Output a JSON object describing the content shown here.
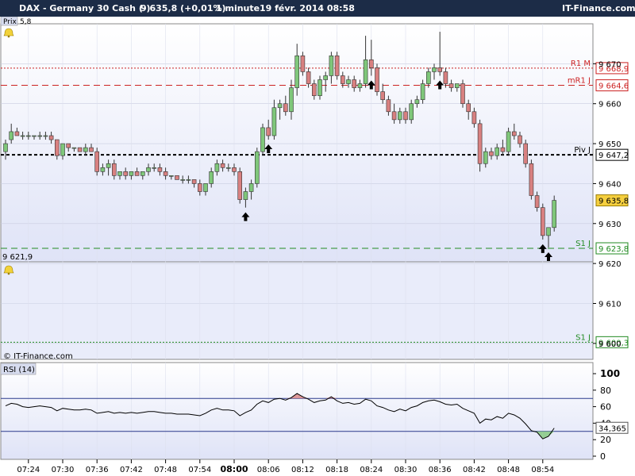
{
  "header": {
    "instrument": "DAX - Germany 30 Cash (-)",
    "quote": "9 635,8 (+0,01%)",
    "timeframe": "1 minute",
    "datetime": "19 févr. 2014 08:58",
    "brand": "IT-Finance.com"
  },
  "panels": {
    "price_tab": "Prix",
    "price_tab_value": "5,8",
    "rsi_tab": "RSI (14)",
    "watermark": "© IT-Finance.com",
    "low_label": "9 621,9"
  },
  "colors": {
    "titlebar": "#1c2c47",
    "up_candle": "#7fc77a",
    "down_candle": "#d88080",
    "panel_bg": "#e9ecfa",
    "resistance": "#cc2222",
    "support": "#228b22",
    "pivot": "#000000",
    "rsi_line": "#000000",
    "rsi_bands": "#2b3a8c"
  },
  "chart_data": [
    {
      "type": "candlestick",
      "title": "DAX - Germany 30 Cash (-)",
      "xlabel": "",
      "ylabel": "",
      "ylim": [
        9596,
        9680
      ],
      "x_ticks": [
        "07:24",
        "07:30",
        "07:36",
        "07:42",
        "07:48",
        "07:54",
        "08:00",
        "08:06",
        "08:12",
        "08:18",
        "08:24",
        "08:30",
        "08:36",
        "08:42",
        "08:48",
        "08:54"
      ],
      "x_tick_emphasis": "08:00",
      "y_ticks": [
        {
          "value": 9600,
          "label": "9 600"
        },
        {
          "value": 9610,
          "label": "9 610"
        },
        {
          "value": 9620,
          "label": "9 620"
        },
        {
          "value": 9630,
          "label": "9 630"
        },
        {
          "value": 9640,
          "label": "9 640"
        },
        {
          "value": 9650,
          "label": "9 650"
        },
        {
          "value": 9660,
          "label": "9 660"
        },
        {
          "value": 9670,
          "label": "9 670"
        }
      ],
      "levels": [
        {
          "name": "R1 M",
          "value": 9668.9,
          "label": "9 668,9",
          "style": "dotted",
          "color": "#cc2222"
        },
        {
          "name": "mR1 J",
          "value": 9664.6,
          "label": "9 664,6",
          "style": "dashed",
          "color": "#cc2222"
        },
        {
          "name": "Piv J",
          "value": 9647.2,
          "label": "9 647,2",
          "style": "dashed-bold",
          "color": "#000000"
        },
        {
          "name": "S1 J",
          "value": 9623.8,
          "label": "9 623,8",
          "style": "dashed",
          "color": "#228b22"
        },
        {
          "name": "S1 J",
          "value": 9600.3,
          "label": "9 600,3",
          "style": "dotted",
          "color": "#228b22"
        }
      ],
      "last": {
        "value": 9635.8,
        "label": "9 635,8"
      },
      "candles": [
        {
          "t": "07:20",
          "o": 9648,
          "h": 9651,
          "l": 9646,
          "c": 9650
        },
        {
          "t": "07:21",
          "o": 9651,
          "h": 9655,
          "l": 9650,
          "c": 9653
        },
        {
          "t": "07:22",
          "o": 9653,
          "h": 9654,
          "l": 9652,
          "c": 9652
        },
        {
          "t": "07:23",
          "o": 9652,
          "h": 9653,
          "l": 9651,
          "c": 9652
        },
        {
          "t": "07:24",
          "o": 9652,
          "h": 9653,
          "l": 9651,
          "c": 9652
        },
        {
          "t": "07:25",
          "o": 9652,
          "h": 9652,
          "l": 9651,
          "c": 9652
        },
        {
          "t": "07:26",
          "o": 9652,
          "h": 9653,
          "l": 9651,
          "c": 9652
        },
        {
          "t": "07:27",
          "o": 9652,
          "h": 9653,
          "l": 9651,
          "c": 9652
        },
        {
          "t": "07:28",
          "o": 9652,
          "h": 9653,
          "l": 9650,
          "c": 9651
        },
        {
          "t": "07:29",
          "o": 9651,
          "h": 9651,
          "l": 9646,
          "c": 9647
        },
        {
          "t": "07:30",
          "o": 9647,
          "h": 9650,
          "l": 9646,
          "c": 9650
        },
        {
          "t": "07:31",
          "o": 9650,
          "h": 9650,
          "l": 9648,
          "c": 9649
        },
        {
          "t": "07:32",
          "o": 9649,
          "h": 9649,
          "l": 9648,
          "c": 9649
        },
        {
          "t": "07:33",
          "o": 9649,
          "h": 9649,
          "l": 9648,
          "c": 9648
        },
        {
          "t": "07:34",
          "o": 9648,
          "h": 9650,
          "l": 9647,
          "c": 9649
        },
        {
          "t": "07:35",
          "o": 9649,
          "h": 9650,
          "l": 9648,
          "c": 9648
        },
        {
          "t": "07:36",
          "o": 9648,
          "h": 9649,
          "l": 9642,
          "c": 9643
        },
        {
          "t": "07:37",
          "o": 9643,
          "h": 9645,
          "l": 9642,
          "c": 9644
        },
        {
          "t": "07:38",
          "o": 9644,
          "h": 9646,
          "l": 9642,
          "c": 9645
        },
        {
          "t": "07:39",
          "o": 9645,
          "h": 9646,
          "l": 9641,
          "c": 9642
        },
        {
          "t": "07:40",
          "o": 9642,
          "h": 9643,
          "l": 9641,
          "c": 9643
        },
        {
          "t": "07:41",
          "o": 9643,
          "h": 9644,
          "l": 9641,
          "c": 9642
        },
        {
          "t": "07:42",
          "o": 9642,
          "h": 9643,
          "l": 9641,
          "c": 9643
        },
        {
          "t": "07:43",
          "o": 9643,
          "h": 9644,
          "l": 9642,
          "c": 9642
        },
        {
          "t": "07:44",
          "o": 9642,
          "h": 9643,
          "l": 9641,
          "c": 9643
        },
        {
          "t": "07:45",
          "o": 9643,
          "h": 9645,
          "l": 9642,
          "c": 9644
        },
        {
          "t": "07:46",
          "o": 9644,
          "h": 9645,
          "l": 9643,
          "c": 9644
        },
        {
          "t": "07:47",
          "o": 9644,
          "h": 9645,
          "l": 9642,
          "c": 9643
        },
        {
          "t": "07:48",
          "o": 9643,
          "h": 9644,
          "l": 9641,
          "c": 9642
        },
        {
          "t": "07:49",
          "o": 9642,
          "h": 9642,
          "l": 9641,
          "c": 9642
        },
        {
          "t": "07:50",
          "o": 9642,
          "h": 9642,
          "l": 9641,
          "c": 9641
        },
        {
          "t": "07:51",
          "o": 9641,
          "h": 9642,
          "l": 9640,
          "c": 9641
        },
        {
          "t": "07:52",
          "o": 9641,
          "h": 9642,
          "l": 9640,
          "c": 9641
        },
        {
          "t": "07:53",
          "o": 9641,
          "h": 9641,
          "l": 9639,
          "c": 9640
        },
        {
          "t": "07:54",
          "o": 9640,
          "h": 9641,
          "l": 9637,
          "c": 9638
        },
        {
          "t": "07:55",
          "o": 9638,
          "h": 9640,
          "l": 9637,
          "c": 9640
        },
        {
          "t": "07:56",
          "o": 9640,
          "h": 9644,
          "l": 9639,
          "c": 9643
        },
        {
          "t": "07:57",
          "o": 9643,
          "h": 9646,
          "l": 9642,
          "c": 9645
        },
        {
          "t": "07:58",
          "o": 9645,
          "h": 9646,
          "l": 9643,
          "c": 9644
        },
        {
          "t": "07:59",
          "o": 9644,
          "h": 9645,
          "l": 9643,
          "c": 9644
        },
        {
          "t": "08:00",
          "o": 9644,
          "h": 9645,
          "l": 9642,
          "c": 9643
        },
        {
          "t": "08:01",
          "o": 9643,
          "h": 9644,
          "l": 9635,
          "c": 9636
        },
        {
          "t": "08:02",
          "o": 9636,
          "h": 9639,
          "l": 9634,
          "c": 9638
        },
        {
          "t": "08:03",
          "o": 9638,
          "h": 9641,
          "l": 9636,
          "c": 9640
        },
        {
          "t": "08:04",
          "o": 9640,
          "h": 9649,
          "l": 9639,
          "c": 9648
        },
        {
          "t": "08:05",
          "o": 9648,
          "h": 9655,
          "l": 9647,
          "c": 9654
        },
        {
          "t": "08:06",
          "o": 9654,
          "h": 9656,
          "l": 9651,
          "c": 9652
        },
        {
          "t": "08:07",
          "o": 9652,
          "h": 9661,
          "l": 9651,
          "c": 9659
        },
        {
          "t": "08:08",
          "o": 9659,
          "h": 9661,
          "l": 9656,
          "c": 9660
        },
        {
          "t": "08:09",
          "o": 9660,
          "h": 9662,
          "l": 9657,
          "c": 9658
        },
        {
          "t": "08:10",
          "o": 9658,
          "h": 9666,
          "l": 9656,
          "c": 9664
        },
        {
          "t": "08:11",
          "o": 9664,
          "h": 9675,
          "l": 9662,
          "c": 9672
        },
        {
          "t": "08:12",
          "o": 9672,
          "h": 9673,
          "l": 9667,
          "c": 9668
        },
        {
          "t": "08:13",
          "o": 9668,
          "h": 9669,
          "l": 9664,
          "c": 9665
        },
        {
          "t": "08:14",
          "o": 9665,
          "h": 9666,
          "l": 9661,
          "c": 9662
        },
        {
          "t": "08:15",
          "o": 9662,
          "h": 9667,
          "l": 9661,
          "c": 9666
        },
        {
          "t": "08:16",
          "o": 9666,
          "h": 9668,
          "l": 9663,
          "c": 9667
        },
        {
          "t": "08:17",
          "o": 9667,
          "h": 9673,
          "l": 9665,
          "c": 9672
        },
        {
          "t": "08:18",
          "o": 9672,
          "h": 9673,
          "l": 9666,
          "c": 9667
        },
        {
          "t": "08:19",
          "o": 9667,
          "h": 9668,
          "l": 9664,
          "c": 9665
        },
        {
          "t": "08:20",
          "o": 9665,
          "h": 9667,
          "l": 9664,
          "c": 9666
        },
        {
          "t": "08:21",
          "o": 9666,
          "h": 9667,
          "l": 9663,
          "c": 9664
        },
        {
          "t": "08:22",
          "o": 9664,
          "h": 9666,
          "l": 9663,
          "c": 9665
        },
        {
          "t": "08:23",
          "o": 9665,
          "h": 9677,
          "l": 9664,
          "c": 9671
        },
        {
          "t": "08:24",
          "o": 9671,
          "h": 9676,
          "l": 9667,
          "c": 9669
        },
        {
          "t": "08:25",
          "o": 9669,
          "h": 9670,
          "l": 9662,
          "c": 9663
        },
        {
          "t": "08:26",
          "o": 9663,
          "h": 9665,
          "l": 9660,
          "c": 9661
        },
        {
          "t": "08:27",
          "o": 9661,
          "h": 9662,
          "l": 9657,
          "c": 9658
        },
        {
          "t": "08:28",
          "o": 9658,
          "h": 9660,
          "l": 9655,
          "c": 9656
        },
        {
          "t": "08:29",
          "o": 9656,
          "h": 9659,
          "l": 9655,
          "c": 9658
        },
        {
          "t": "08:30",
          "o": 9658,
          "h": 9659,
          "l": 9655,
          "c": 9656
        },
        {
          "t": "08:31",
          "o": 9656,
          "h": 9661,
          "l": 9655,
          "c": 9660
        },
        {
          "t": "08:32",
          "o": 9660,
          "h": 9662,
          "l": 9659,
          "c": 9661
        },
        {
          "t": "08:33",
          "o": 9661,
          "h": 9666,
          "l": 9660,
          "c": 9665
        },
        {
          "t": "08:34",
          "o": 9665,
          "h": 9669,
          "l": 9664,
          "c": 9668
        },
        {
          "t": "08:35",
          "o": 9668,
          "h": 9670,
          "l": 9666,
          "c": 9669
        },
        {
          "t": "08:36",
          "o": 9669,
          "h": 9678,
          "l": 9667,
          "c": 9668
        },
        {
          "t": "08:37",
          "o": 9668,
          "h": 9669,
          "l": 9664,
          "c": 9665
        },
        {
          "t": "08:38",
          "o": 9665,
          "h": 9666,
          "l": 9663,
          "c": 9664
        },
        {
          "t": "08:39",
          "o": 9664,
          "h": 9665,
          "l": 9663,
          "c": 9665
        },
        {
          "t": "08:40",
          "o": 9665,
          "h": 9666,
          "l": 9659,
          "c": 9660
        },
        {
          "t": "08:41",
          "o": 9660,
          "h": 9661,
          "l": 9656,
          "c": 9658
        },
        {
          "t": "08:42",
          "o": 9658,
          "h": 9659,
          "l": 9654,
          "c": 9655
        },
        {
          "t": "08:43",
          "o": 9655,
          "h": 9656,
          "l": 9643,
          "c": 9645
        },
        {
          "t": "08:44",
          "o": 9645,
          "h": 9649,
          "l": 9644,
          "c": 9648
        },
        {
          "t": "08:45",
          "o": 9648,
          "h": 9649,
          "l": 9646,
          "c": 9647
        },
        {
          "t": "08:46",
          "o": 9647,
          "h": 9650,
          "l": 9646,
          "c": 9649
        },
        {
          "t": "08:47",
          "o": 9649,
          "h": 9651,
          "l": 9647,
          "c": 9648
        },
        {
          "t": "08:48",
          "o": 9648,
          "h": 9654,
          "l": 9647,
          "c": 9653
        },
        {
          "t": "08:49",
          "o": 9653,
          "h": 9655,
          "l": 9651,
          "c": 9652
        },
        {
          "t": "08:50",
          "o": 9652,
          "h": 9653,
          "l": 9649,
          "c": 9650
        },
        {
          "t": "08:51",
          "o": 9650,
          "h": 9651,
          "l": 9644,
          "c": 9645
        },
        {
          "t": "08:52",
          "o": 9645,
          "h": 9646,
          "l": 9636,
          "c": 9637
        },
        {
          "t": "08:53",
          "o": 9637,
          "h": 9638,
          "l": 9633,
          "c": 9634
        },
        {
          "t": "08:54",
          "o": 9634,
          "h": 9635,
          "l": 9626,
          "c": 9627
        },
        {
          "t": "08:55",
          "o": 9627,
          "h": 9629,
          "l": 9624,
          "c": 9629
        },
        {
          "t": "08:56",
          "o": 9629,
          "h": 9637,
          "l": 9628,
          "c": 9635.8
        }
      ],
      "buy_signals": [
        "08:02",
        "08:06",
        "08:24",
        "08:36",
        "08:54",
        "08:55"
      ]
    },
    {
      "type": "line",
      "title": "RSI (14)",
      "xlabel": "",
      "ylabel": "",
      "ylim": [
        0,
        100
      ],
      "y_ticks": [
        0,
        20,
        40,
        60,
        80,
        100
      ],
      "bands": [
        70,
        30
      ],
      "last": {
        "value": 34.365,
        "label": "34,365"
      },
      "series": [
        {
          "values": [
            61,
            64,
            63,
            60,
            59,
            60,
            61,
            60,
            59,
            55,
            58,
            57,
            56,
            56,
            57,
            56,
            52,
            53,
            54,
            52,
            53,
            52,
            53,
            52,
            53,
            54,
            54,
            53,
            52,
            52,
            51,
            51,
            51,
            50,
            49,
            52,
            56,
            58,
            56,
            56,
            55,
            49,
            53,
            56,
            63,
            67,
            65,
            69,
            70,
            68,
            71,
            76,
            72,
            69,
            65,
            67,
            68,
            72,
            67,
            64,
            65,
            63,
            64,
            69,
            67,
            61,
            59,
            56,
            54,
            57,
            55,
            59,
            61,
            65,
            67,
            68,
            66,
            63,
            62,
            63,
            58,
            55,
            52,
            40,
            45,
            44,
            48,
            46,
            52,
            50,
            46,
            39,
            31,
            29,
            21,
            24,
            34
          ]
        }
      ]
    }
  ]
}
